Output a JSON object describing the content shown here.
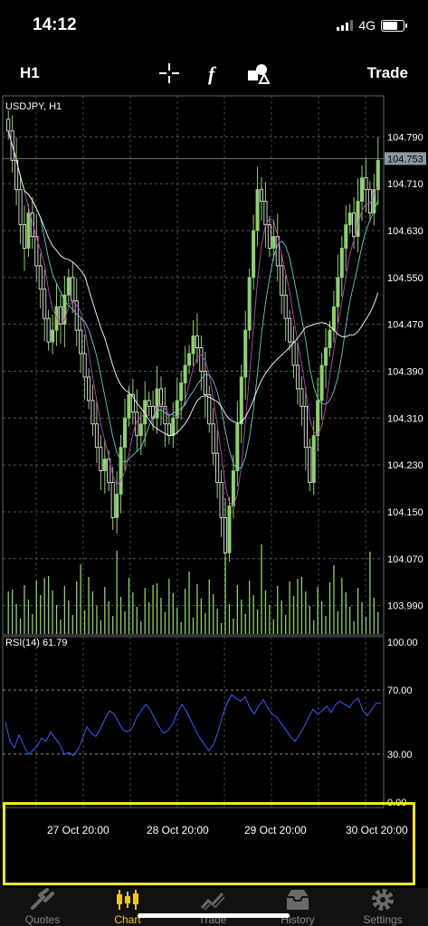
{
  "status_bar": {
    "time": "14:12",
    "network": "4G"
  },
  "toolbar": {
    "timeframe": "H1",
    "trade_label": "Trade",
    "icons": [
      "crosshair-icon",
      "indicators-icon",
      "objects-icon"
    ]
  },
  "chart_data": {
    "type": "candlestick",
    "symbol_label": "USDJPY, H1",
    "current_price": "104.753",
    "price_ticks": [
      "104.790",
      "104.710",
      "104.630",
      "104.550",
      "104.470",
      "104.390",
      "104.310",
      "104.230",
      "104.150",
      "104.070",
      "103.990"
    ],
    "ylim": [
      103.94,
      104.86
    ],
    "date_labels": [
      "27 Oct 20:00",
      "28 Oct 20:00",
      "29 Oct 20:00",
      "30 Oct 20:00"
    ],
    "closes": [
      104.8,
      104.75,
      104.7,
      104.64,
      104.6,
      104.66,
      104.62,
      104.57,
      104.53,
      104.48,
      104.44,
      104.46,
      104.5,
      104.47,
      104.52,
      104.55,
      104.51,
      104.46,
      104.42,
      104.38,
      104.34,
      104.3,
      104.26,
      104.22,
      104.24,
      104.2,
      104.14,
      104.18,
      104.26,
      104.31,
      104.35,
      104.32,
      104.28,
      104.3,
      104.34,
      104.33,
      104.31,
      104.36,
      104.33,
      104.3,
      104.28,
      104.31,
      104.34,
      104.37,
      104.4,
      104.42,
      104.45,
      104.43,
      104.39,
      104.35,
      104.3,
      104.25,
      104.2,
      104.14,
      104.08,
      104.16,
      104.22,
      104.3,
      104.38,
      104.46,
      104.55,
      104.63,
      104.7,
      104.68,
      104.64,
      104.6,
      104.62,
      104.57,
      104.52,
      104.48,
      104.44,
      104.4,
      104.36,
      104.33,
      104.26,
      104.2,
      104.28,
      104.34,
      104.4,
      104.43,
      104.46,
      104.5,
      104.55,
      104.6,
      104.64,
      104.66,
      104.62,
      104.68,
      104.72,
      104.7,
      104.66,
      104.7,
      104.75
    ],
    "rsi": {
      "label": "RSI(14) 61.79",
      "levels": [
        "100.00",
        "70.00",
        "30.00",
        "0.00"
      ],
      "values": [
        50,
        38,
        34,
        42,
        36,
        30,
        32,
        35,
        40,
        38,
        44,
        40,
        36,
        30,
        31,
        29,
        33,
        39,
        47,
        43,
        41,
        46,
        52,
        57,
        55,
        50,
        45,
        44,
        46,
        53,
        57,
        61,
        58,
        52,
        47,
        43,
        45,
        49,
        56,
        61,
        57,
        51,
        45,
        40,
        36,
        32,
        36,
        44,
        54,
        62,
        67,
        65,
        63,
        66,
        59,
        55,
        60,
        64,
        59,
        55,
        53,
        49,
        45,
        41,
        38,
        42,
        47,
        53,
        58,
        55,
        57,
        60,
        56,
        61,
        63,
        61,
        59,
        63,
        65,
        57,
        54,
        58,
        62,
        61.79
      ]
    }
  },
  "tab_bar": {
    "items": [
      {
        "label": "Quotes",
        "icon": "quotes-icon"
      },
      {
        "label": "Chart",
        "icon": "chart-icon"
      },
      {
        "label": "Trade",
        "icon": "trade-icon"
      },
      {
        "label": "History",
        "icon": "history-icon"
      },
      {
        "label": "Settings",
        "icon": "settings-icon"
      }
    ],
    "active": "Chart"
  },
  "colors": {
    "accent": "#f2c811",
    "bull": "#8fd16a",
    "bear": "#ffffff",
    "rsi_line": "#3b5bff",
    "highlight": "#f2e81a"
  }
}
